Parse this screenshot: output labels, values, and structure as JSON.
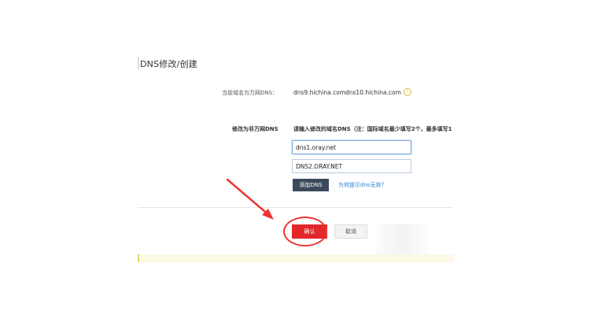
{
  "section": {
    "title": "DNS修改/创建"
  },
  "current_dns": {
    "label": "当前域名为万网DNS：",
    "values": [
      "dns9.hichina.com",
      "dns10.hichina.com"
    ],
    "info_icon": "info-icon"
  },
  "modify": {
    "label": "修改为非万网DNS",
    "hint": "请输入修改的域名DNS（注：国际域名最少填写2个，最多填写1",
    "inputs": [
      {
        "value": "dns1.oray.net"
      },
      {
        "value": "DNS2.ORAY.NET"
      }
    ],
    "add_button": "添加DNS",
    "help_link": "为何提示dns无效？"
  },
  "actions": {
    "confirm": "确认",
    "cancel": "取消"
  },
  "colors": {
    "confirm_red": "#e2282b",
    "annotation_red": "#e33",
    "add_button_bg": "#3b4a5a",
    "link_blue": "#2a7fd4"
  }
}
